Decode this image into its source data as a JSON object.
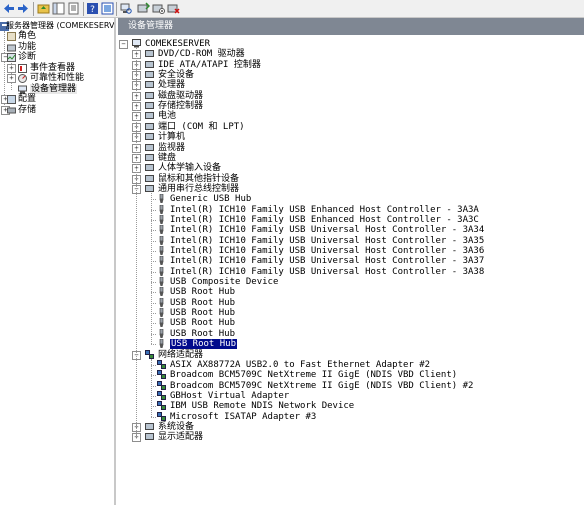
{
  "window": {
    "left_tree": {
      "root": "服务器管理器 (COMEKESERVER)",
      "items": [
        {
          "label": "角色",
          "icon": "roles-icon"
        },
        {
          "label": "功能",
          "icon": "features-icon"
        },
        {
          "label": "诊断",
          "icon": "diagnostics-icon"
        },
        {
          "label": "事件查看器",
          "icon": "event-viewer-icon"
        },
        {
          "label": "可靠性和性能",
          "icon": "reliability-icon"
        },
        {
          "label": "设备管理器",
          "icon": "device-manager-icon"
        },
        {
          "label": "配置",
          "icon": "configuration-icon"
        },
        {
          "label": "存储",
          "icon": "storage-icon"
        }
      ]
    },
    "right_pane": {
      "header": "设备管理器",
      "computer": "COMEKESERVER",
      "categories": [
        "DVD/CD-ROM 驱动器",
        "IDE ATA/ATAPI 控制器",
        "安全设备",
        "处理器",
        "磁盘驱动器",
        "存储控制器",
        "电池",
        "端口 (COM 和 LPT)",
        "计算机",
        "监视器",
        "键盘",
        "人体学输入设备",
        "鼠标和其他指针设备",
        "通用串行总线控制器"
      ],
      "usb_devices": [
        "Generic USB Hub",
        "Intel(R) ICH10 Family USB Enhanced Host Controller - 3A3A",
        "Intel(R) ICH10 Family USB Enhanced Host Controller - 3A3C",
        "Intel(R) ICH10 Family USB Universal Host Controller - 3A34",
        "Intel(R) ICH10 Family USB Universal Host Controller - 3A35",
        "Intel(R) ICH10 Family USB Universal Host Controller - 3A36",
        "Intel(R) ICH10 Family USB Universal Host Controller - 3A37",
        "Intel(R) ICH10 Family USB Universal Host Controller - 3A38",
        "USB Composite Device",
        "USB Root Hub",
        "USB Root Hub",
        "USB Root Hub",
        "USB Root Hub",
        "USB Root Hub",
        "USB Root Hub"
      ],
      "network_category": "网络适配器",
      "network_devices": [
        "ASIX AX88772A USB2.0 to Fast Ethernet Adapter #2",
        "Broadcom BCM5709C NetXtreme II GigE (NDIS VBD Client)",
        "Broadcom BCM5709C NetXtreme II GigE (NDIS VBD Client) #2",
        "GBHost Virtual Adapter",
        "IBM USB Remote NDIS Network Device",
        "Microsoft ISATAP Adapter #3"
      ],
      "trailing_categories": [
        "系统设备",
        "显示适配器"
      ],
      "selected": "USB Root Hub"
    },
    "colors": {
      "header_bg": "#7f8793",
      "selection_bg": "#000b8c",
      "toolbar_bg": "#f0f0f0"
    }
  }
}
